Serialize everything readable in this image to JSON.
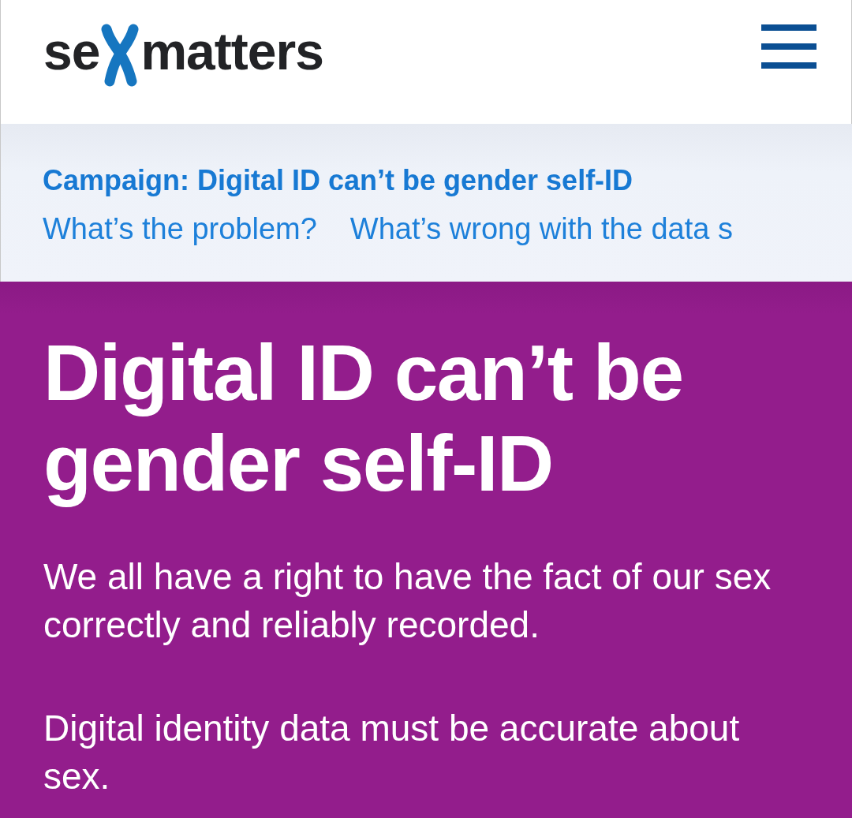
{
  "header": {
    "logo": {
      "before": "se",
      "after": "matters"
    }
  },
  "subnav": {
    "title": "Campaign: Digital ID can’t be gender self-ID",
    "links": [
      "What’s the problem?",
      "What’s wrong with the data s"
    ]
  },
  "hero": {
    "title": "Digital ID can’t be gender self-ID",
    "paragraphs": [
      "We all have a right to have the fact of our sex correctly and reliably recorded.",
      "Digital identity data must be accurate about sex."
    ]
  }
}
